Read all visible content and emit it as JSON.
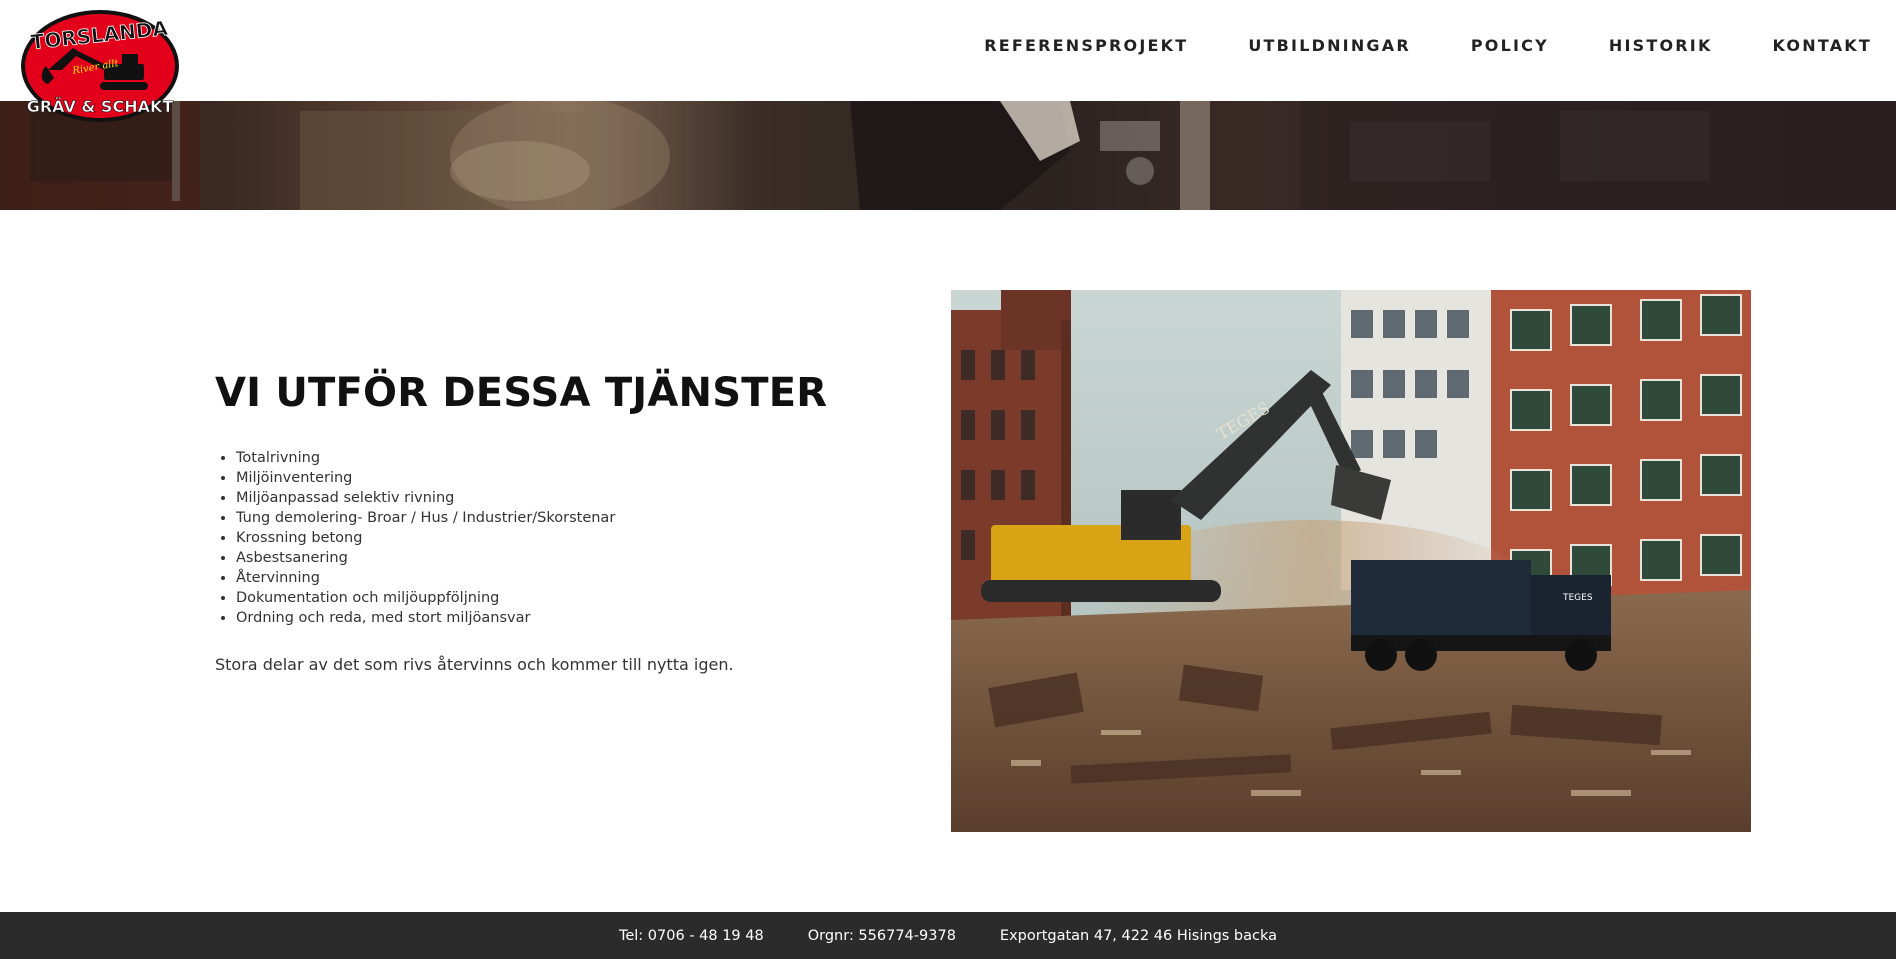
{
  "brand": {
    "logo_top": "TORSLANDA",
    "logo_bottom": "GRÄV & SCHAKT",
    "logo_tagline": "River allt",
    "logo_red": "#e3001b",
    "logo_black": "#111111"
  },
  "nav": {
    "items": [
      {
        "label": "REFERENSPROJEKT"
      },
      {
        "label": "UTBILDNINGAR"
      },
      {
        "label": "POLICY"
      },
      {
        "label": "HISTORIK"
      },
      {
        "label": "KONTAKT"
      }
    ]
  },
  "main": {
    "heading": "VI UTFÖR DESSA TJÄNSTER",
    "services": [
      "Totalrivning",
      "Miljöinventering",
      "Miljöanpassad selektiv rivning",
      "Tung demolering- Broar / Hus / Industrier/Skorstenar",
      "Krossning betong",
      "Asbestsanering",
      "Återvinning",
      "Dokumentation och miljöuppföljning",
      "Ordning och reda, med stort  miljöansvar"
    ],
    "lead": "Stora delar av det som rivs återvinns och kommer till nytta igen.",
    "photo_text": {
      "excavator_brand": "TEGES",
      "truck_brand": "TEGES"
    }
  },
  "footer": {
    "phone": "Tel: 0706 - 48 19 48",
    "orgnr": "Orgnr: 556774-9378",
    "address": "Exportgatan 47, 422 46 Hisings backa",
    "background": "#2b2b2b"
  }
}
